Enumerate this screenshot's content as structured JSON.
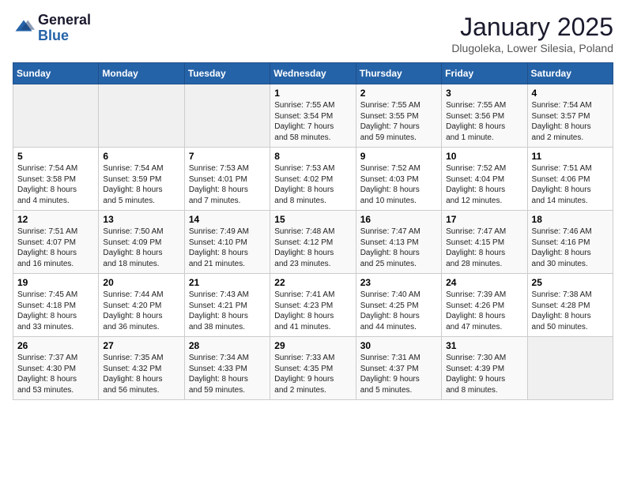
{
  "header": {
    "logo_general": "General",
    "logo_blue": "Blue",
    "month_title": "January 2025",
    "location": "Dlugoleka, Lower Silesia, Poland"
  },
  "days_of_week": [
    "Sunday",
    "Monday",
    "Tuesday",
    "Wednesday",
    "Thursday",
    "Friday",
    "Saturday"
  ],
  "weeks": [
    [
      {
        "day": "",
        "info": ""
      },
      {
        "day": "",
        "info": ""
      },
      {
        "day": "",
        "info": ""
      },
      {
        "day": "1",
        "info": "Sunrise: 7:55 AM\nSunset: 3:54 PM\nDaylight: 7 hours\nand 58 minutes."
      },
      {
        "day": "2",
        "info": "Sunrise: 7:55 AM\nSunset: 3:55 PM\nDaylight: 7 hours\nand 59 minutes."
      },
      {
        "day": "3",
        "info": "Sunrise: 7:55 AM\nSunset: 3:56 PM\nDaylight: 8 hours\nand 1 minute."
      },
      {
        "day": "4",
        "info": "Sunrise: 7:54 AM\nSunset: 3:57 PM\nDaylight: 8 hours\nand 2 minutes."
      }
    ],
    [
      {
        "day": "5",
        "info": "Sunrise: 7:54 AM\nSunset: 3:58 PM\nDaylight: 8 hours\nand 4 minutes."
      },
      {
        "day": "6",
        "info": "Sunrise: 7:54 AM\nSunset: 3:59 PM\nDaylight: 8 hours\nand 5 minutes."
      },
      {
        "day": "7",
        "info": "Sunrise: 7:53 AM\nSunset: 4:01 PM\nDaylight: 8 hours\nand 7 minutes."
      },
      {
        "day": "8",
        "info": "Sunrise: 7:53 AM\nSunset: 4:02 PM\nDaylight: 8 hours\nand 8 minutes."
      },
      {
        "day": "9",
        "info": "Sunrise: 7:52 AM\nSunset: 4:03 PM\nDaylight: 8 hours\nand 10 minutes."
      },
      {
        "day": "10",
        "info": "Sunrise: 7:52 AM\nSunset: 4:04 PM\nDaylight: 8 hours\nand 12 minutes."
      },
      {
        "day": "11",
        "info": "Sunrise: 7:51 AM\nSunset: 4:06 PM\nDaylight: 8 hours\nand 14 minutes."
      }
    ],
    [
      {
        "day": "12",
        "info": "Sunrise: 7:51 AM\nSunset: 4:07 PM\nDaylight: 8 hours\nand 16 minutes."
      },
      {
        "day": "13",
        "info": "Sunrise: 7:50 AM\nSunset: 4:09 PM\nDaylight: 8 hours\nand 18 minutes."
      },
      {
        "day": "14",
        "info": "Sunrise: 7:49 AM\nSunset: 4:10 PM\nDaylight: 8 hours\nand 21 minutes."
      },
      {
        "day": "15",
        "info": "Sunrise: 7:48 AM\nSunset: 4:12 PM\nDaylight: 8 hours\nand 23 minutes."
      },
      {
        "day": "16",
        "info": "Sunrise: 7:47 AM\nSunset: 4:13 PM\nDaylight: 8 hours\nand 25 minutes."
      },
      {
        "day": "17",
        "info": "Sunrise: 7:47 AM\nSunset: 4:15 PM\nDaylight: 8 hours\nand 28 minutes."
      },
      {
        "day": "18",
        "info": "Sunrise: 7:46 AM\nSunset: 4:16 PM\nDaylight: 8 hours\nand 30 minutes."
      }
    ],
    [
      {
        "day": "19",
        "info": "Sunrise: 7:45 AM\nSunset: 4:18 PM\nDaylight: 8 hours\nand 33 minutes."
      },
      {
        "day": "20",
        "info": "Sunrise: 7:44 AM\nSunset: 4:20 PM\nDaylight: 8 hours\nand 36 minutes."
      },
      {
        "day": "21",
        "info": "Sunrise: 7:43 AM\nSunset: 4:21 PM\nDaylight: 8 hours\nand 38 minutes."
      },
      {
        "day": "22",
        "info": "Sunrise: 7:41 AM\nSunset: 4:23 PM\nDaylight: 8 hours\nand 41 minutes."
      },
      {
        "day": "23",
        "info": "Sunrise: 7:40 AM\nSunset: 4:25 PM\nDaylight: 8 hours\nand 44 minutes."
      },
      {
        "day": "24",
        "info": "Sunrise: 7:39 AM\nSunset: 4:26 PM\nDaylight: 8 hours\nand 47 minutes."
      },
      {
        "day": "25",
        "info": "Sunrise: 7:38 AM\nSunset: 4:28 PM\nDaylight: 8 hours\nand 50 minutes."
      }
    ],
    [
      {
        "day": "26",
        "info": "Sunrise: 7:37 AM\nSunset: 4:30 PM\nDaylight: 8 hours\nand 53 minutes."
      },
      {
        "day": "27",
        "info": "Sunrise: 7:35 AM\nSunset: 4:32 PM\nDaylight: 8 hours\nand 56 minutes."
      },
      {
        "day": "28",
        "info": "Sunrise: 7:34 AM\nSunset: 4:33 PM\nDaylight: 8 hours\nand 59 minutes."
      },
      {
        "day": "29",
        "info": "Sunrise: 7:33 AM\nSunset: 4:35 PM\nDaylight: 9 hours\nand 2 minutes."
      },
      {
        "day": "30",
        "info": "Sunrise: 7:31 AM\nSunset: 4:37 PM\nDaylight: 9 hours\nand 5 minutes."
      },
      {
        "day": "31",
        "info": "Sunrise: 7:30 AM\nSunset: 4:39 PM\nDaylight: 9 hours\nand 8 minutes."
      },
      {
        "day": "",
        "info": ""
      }
    ]
  ]
}
